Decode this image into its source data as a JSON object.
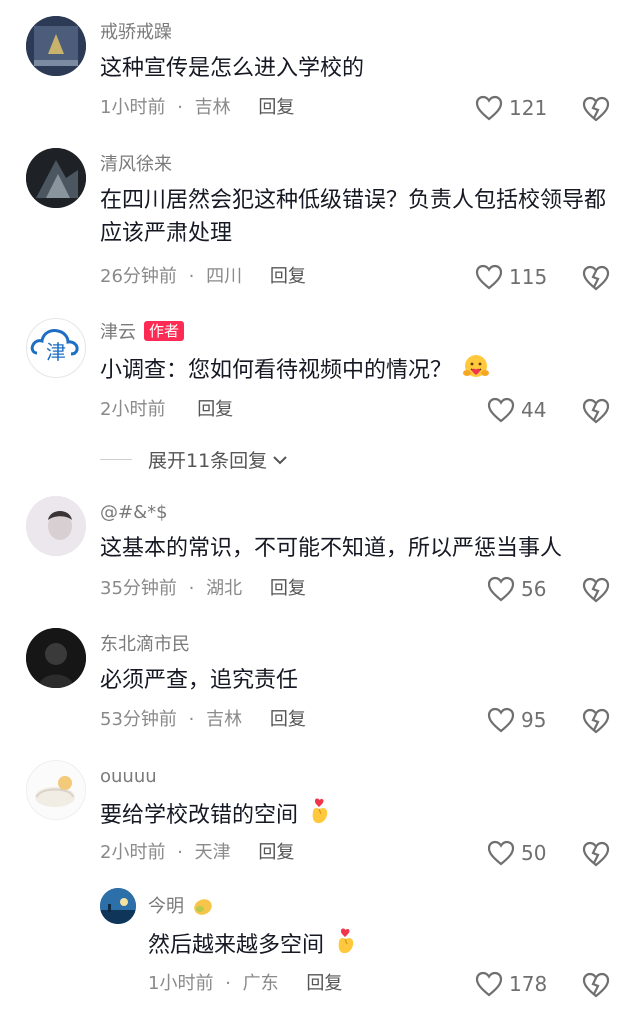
{
  "comments": [
    {
      "username": "戒骄戒躁",
      "text": "这种宣传是怎么进入学校的",
      "time": "1小时前",
      "location": "吉林",
      "reply": "回复",
      "likes": "121"
    },
    {
      "username": "清风徐来",
      "text": "在四川居然会犯这种低级错误？负责人包括校领导都应该严肃处理",
      "time": "26分钟前",
      "location": "四川",
      "reply": "回复",
      "likes": "115"
    },
    {
      "username": "津云",
      "badge": "作者",
      "avatar_text": "津",
      "text": "小调查：您如何看待视频中的情况？",
      "time": "2小时前",
      "reply": "回复",
      "likes": "44"
    },
    {
      "username": "@#&*$",
      "text": "这基本的常识，不可能不知道，所以严惩当事人",
      "time": "35分钟前",
      "location": "湖北",
      "reply": "回复",
      "likes": "56"
    },
    {
      "username": "东北滴市民",
      "text": "必须严查，追究责任",
      "time": "53分钟前",
      "location": "吉林",
      "reply": "回复",
      "likes": "95"
    },
    {
      "username": "ouuuu",
      "text": "要给学校改错的空间",
      "time": "2小时前",
      "location": "天津",
      "reply": "回复",
      "likes": "50"
    },
    {
      "username": "今明",
      "text": "然后越来越多空间",
      "time": "1小时前",
      "location": "广东",
      "reply": "回复",
      "likes": "178"
    }
  ],
  "expand_replies": "展开11条回复",
  "separator": "·",
  "icons": {
    "like": "heart-outline-icon",
    "dislike": "broken-heart-icon",
    "expand": "chevron-down-icon"
  },
  "colors": {
    "author_badge": "#fe2c55",
    "username": "#7a7a7a",
    "text": "#161823",
    "meta": "#8a8a8a"
  }
}
